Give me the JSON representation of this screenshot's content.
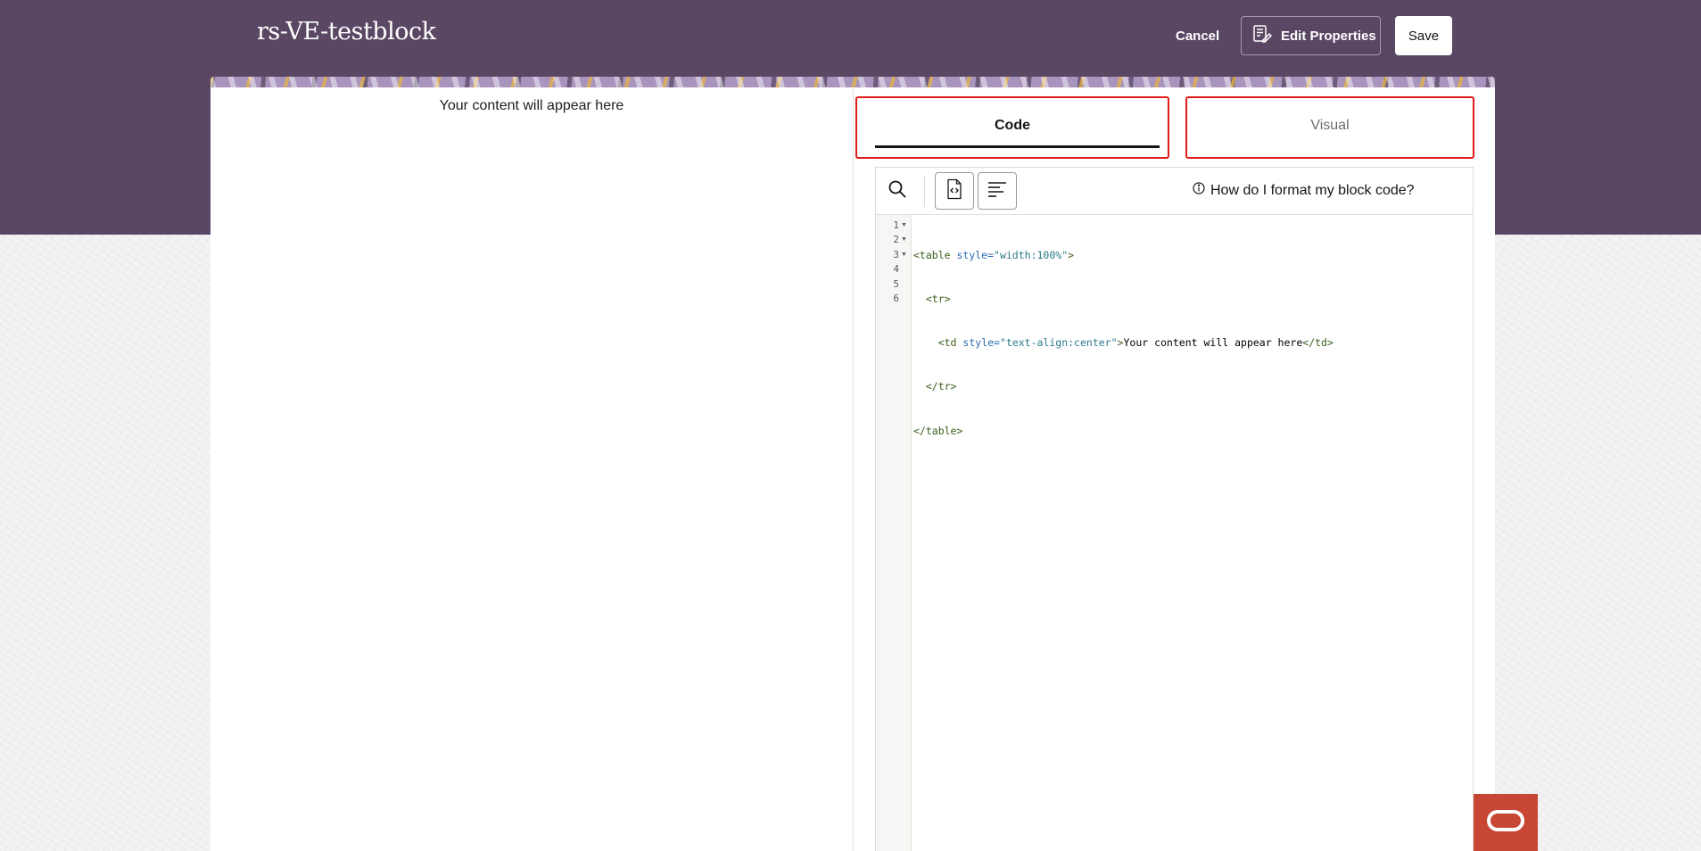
{
  "header": {
    "title": "rs-VE-testblock",
    "cancel_label": "Cancel",
    "edit_properties_label": "Edit Properties",
    "save_label": "Save"
  },
  "preview": {
    "text": "Your content will appear here"
  },
  "tabs": [
    {
      "label": "Code",
      "active": true
    },
    {
      "label": "Visual",
      "active": false
    }
  ],
  "editor": {
    "toolbar": {
      "icons": [
        "search-icon",
        "source-file-icon",
        "format-align-icon"
      ],
      "help_link": "How do I format my block code?",
      "help_icon": "info-icon"
    },
    "line_numbers": [
      "1",
      "2",
      "3",
      "4",
      "5",
      "6"
    ],
    "lines": [
      {
        "tag_open": "<table",
        "attr": "style=",
        "value": "\"width:100%\"",
        "tag_close": ">"
      },
      {
        "tag": "<tr>"
      },
      {
        "tag_open": "<td",
        "attr": "style=",
        "value": "\"text-align:center\"",
        "tag_close": ">",
        "text": "Your content will appear here",
        "end_tag": "</td>"
      },
      {
        "tag": "</tr>"
      },
      {
        "tag": "</table>"
      },
      {
        "tag": ""
      }
    ]
  },
  "colors": {
    "header_bg": "#594764",
    "highlight_border": "#e21b1b",
    "chat_badge": "#c74634"
  }
}
